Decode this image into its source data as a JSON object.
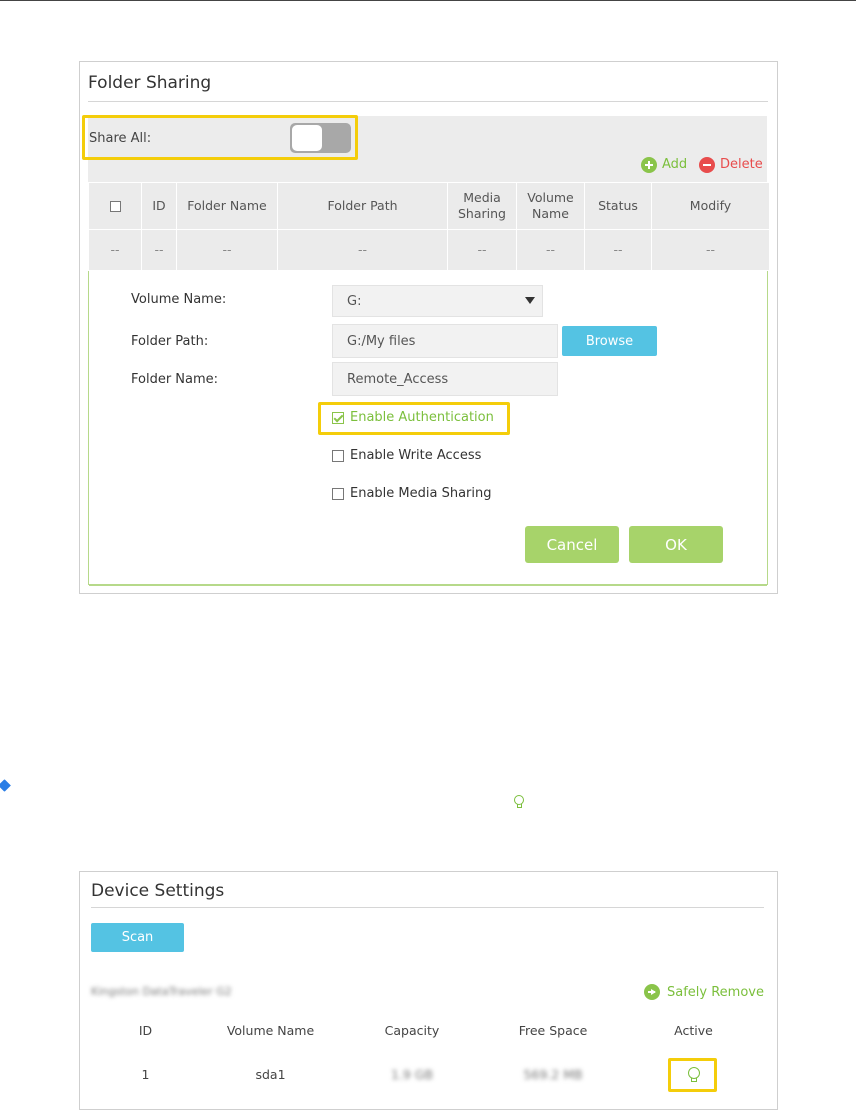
{
  "folder_sharing": {
    "title": "Folder Sharing",
    "share_all_label": "Share All:",
    "share_all_on": false,
    "add_label": "Add",
    "delete_label": "Delete",
    "columns": [
      "",
      "ID",
      "Folder Name",
      "Folder Path",
      "Media Sharing",
      "Volume Name",
      "Status",
      "Modify"
    ],
    "empty_row": [
      "--",
      "--",
      "--",
      "--",
      "--",
      "--",
      "--",
      "--"
    ],
    "form": {
      "volume_name_label": "Volume Name:",
      "volume_name_value": "G:",
      "folder_path_label": "Folder Path:",
      "folder_path_value": "G:/My files",
      "browse_label": "Browse",
      "folder_name_label": "Folder Name:",
      "folder_name_value": "Remote_Access",
      "enable_auth_label": "Enable Authentication",
      "enable_auth_checked": true,
      "enable_write_label": "Enable Write Access",
      "enable_write_checked": false,
      "enable_media_label": "Enable Media Sharing",
      "enable_media_checked": false,
      "cancel_label": "Cancel",
      "ok_label": "OK"
    }
  },
  "device_settings": {
    "title": "Device Settings",
    "scan_label": "Scan",
    "device_name": "Kingston DataTraveler G2",
    "safely_remove_label": "Safely Remove",
    "columns": [
      "ID",
      "Volume Name",
      "Capacity",
      "Free Space",
      "Active"
    ],
    "rows": [
      {
        "id": "1",
        "volume_name": "sda1",
        "capacity": "1.9 GB",
        "free_space": "569.2 MB",
        "active_icon": "lightbulb-icon"
      }
    ]
  },
  "colors": {
    "highlight": "#f4cd0a",
    "green_accent": "#8ac44a",
    "delete_red": "#e84c4c",
    "button_blue": "#54c3e3",
    "button_green": "#a7d36a"
  }
}
